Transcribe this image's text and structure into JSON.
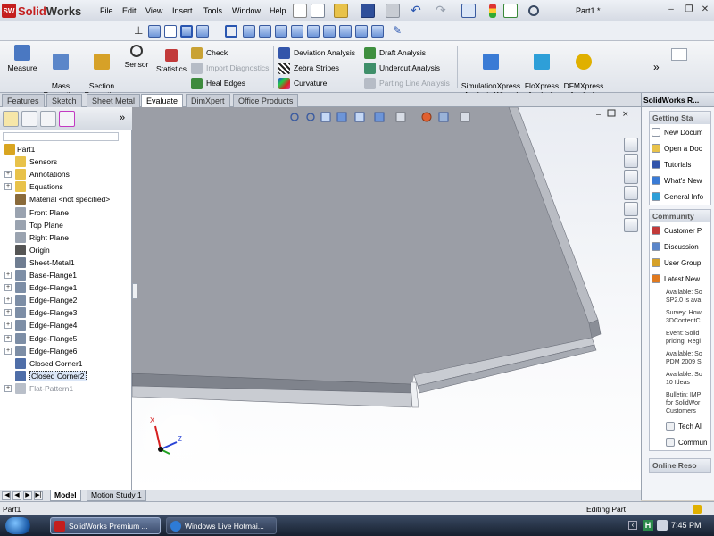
{
  "app": {
    "logo_badge": "SW",
    "logo_text_a": "Solid",
    "logo_text_b": "Works",
    "doc_title": "Part1 *",
    "win_minimize": "–",
    "win_restore": "❐",
    "win_close": "✕"
  },
  "menu": [
    "File",
    "Edit",
    "View",
    "Insert",
    "Tools",
    "Window",
    "Help"
  ],
  "command_manager": {
    "large_buttons": [
      {
        "label": "Measure",
        "icon": "ruler-icon",
        "color": "#4a78c2"
      },
      {
        "label": "Mass\nProperties",
        "icon": "scale-icon",
        "color": "#5b86c9"
      },
      {
        "label": "Section\nProperties",
        "icon": "section-icon",
        "color": "#d6a128"
      },
      {
        "label": "Sensor",
        "icon": "sensor-icon",
        "color": "#333333"
      },
      {
        "label": "Statistics",
        "icon": "statistics-icon",
        "color": "#c23a3a"
      }
    ],
    "small_col1": [
      {
        "label": "Check",
        "icon": "check-icon",
        "color": "#c9a235",
        "disabled": false
      },
      {
        "label": "Import Diagnostics",
        "icon": "diagnostics-icon",
        "color": "#b6bcc6",
        "disabled": true
      },
      {
        "label": "Heal Edges",
        "icon": "heal-edges-icon",
        "color": "#3d8a3d",
        "disabled": false
      }
    ],
    "small_col2": [
      {
        "label": "Deviation Analysis",
        "icon": "deviation-icon",
        "color": "#3355aa",
        "disabled": false
      },
      {
        "label": "Zebra Stripes",
        "icon": "zebra-icon",
        "color": "#222222",
        "disabled": false
      },
      {
        "label": "Curvature",
        "icon": "curvature-icon",
        "color": "#d43fa6",
        "disabled": false
      }
    ],
    "small_col3": [
      {
        "label": "Draft Analysis",
        "icon": "draft-icon",
        "color": "#3f8f3f",
        "disabled": false
      },
      {
        "label": "Undercut Analysis",
        "icon": "undercut-icon",
        "color": "#3f8f6a",
        "disabled": false
      },
      {
        "label": "Parting Line Analysis",
        "icon": "parting-line-icon",
        "color": "#b6bcc6",
        "disabled": true
      }
    ],
    "xpress_buttons": [
      {
        "label": "SimulationXpress\nAnalysis Wizard",
        "icon": "simulationxpress-icon",
        "color": "#3a7bd5"
      },
      {
        "label": "FloXpress\nAnalysis\nWizard",
        "icon": "floxpress-icon",
        "color": "#2e9fd8"
      },
      {
        "label": "DFMXpress\nAnalysis\nWizard",
        "icon": "dfmxpress-icon",
        "color": "#e0b000"
      }
    ],
    "more_chevron": "»"
  },
  "tabs": [
    {
      "label": "Features",
      "active": false
    },
    {
      "label": "Sketch",
      "active": false
    },
    {
      "label": "Sheet Metal",
      "active": false
    },
    {
      "label": "Evaluate",
      "active": true
    },
    {
      "label": "DimXpert",
      "active": false
    },
    {
      "label": "Office Products",
      "active": false
    }
  ],
  "feature_tree": [
    {
      "label": "Part1",
      "icon": "part-icon",
      "color": "#d9a520",
      "expand": "",
      "root": true
    },
    {
      "label": "Sensors",
      "icon": "sensors-folder-icon",
      "color": "#e8c24a",
      "expand": ""
    },
    {
      "label": "Annotations",
      "icon": "annotations-icon",
      "color": "#e8c24a",
      "expand": "+"
    },
    {
      "label": "Equations",
      "icon": "equations-icon",
      "color": "#e8c24a",
      "expand": "+"
    },
    {
      "label": "Material <not specified>",
      "icon": "material-icon",
      "color": "#8a6a3a",
      "expand": ""
    },
    {
      "label": "Front Plane",
      "icon": "plane-icon",
      "color": "#9aa3b0",
      "expand": ""
    },
    {
      "label": "Top Plane",
      "icon": "plane-icon",
      "color": "#9aa3b0",
      "expand": ""
    },
    {
      "label": "Right Plane",
      "icon": "plane-icon",
      "color": "#9aa3b0",
      "expand": ""
    },
    {
      "label": "Origin",
      "icon": "origin-icon",
      "color": "#555555",
      "expand": ""
    },
    {
      "label": "Sheet-Metal1",
      "icon": "sheet-metal-icon",
      "color": "#6f7d91",
      "expand": ""
    },
    {
      "label": "Base-Flange1",
      "icon": "flange-icon",
      "color": "#7d8ea6",
      "expand": "+"
    },
    {
      "label": "Edge-Flange1",
      "icon": "flange-icon",
      "color": "#7d8ea6",
      "expand": "+"
    },
    {
      "label": "Edge-Flange2",
      "icon": "flange-icon",
      "color": "#7d8ea6",
      "expand": "+"
    },
    {
      "label": "Edge-Flange3",
      "icon": "flange-icon",
      "color": "#7d8ea6",
      "expand": "+"
    },
    {
      "label": "Edge-Flange4",
      "icon": "flange-icon",
      "color": "#7d8ea6",
      "expand": "+"
    },
    {
      "label": "Edge-Flange5",
      "icon": "flange-icon",
      "color": "#7d8ea6",
      "expand": "+"
    },
    {
      "label": "Edge-Flange6",
      "icon": "flange-icon",
      "color": "#7d8ea6",
      "expand": "+"
    },
    {
      "label": "Closed Corner1",
      "icon": "closed-corner-icon",
      "color": "#4f6ea8",
      "expand": ""
    },
    {
      "label": "Closed Corner2",
      "icon": "closed-corner-icon",
      "color": "#4f6ea8",
      "expand": "",
      "selected": true
    },
    {
      "label": "Flat-Pattern1",
      "icon": "flat-pattern-icon",
      "color": "#b9bfc9",
      "expand": "+",
      "suppressed": true
    }
  ],
  "task_pane": {
    "title": "SolidWorks R...",
    "getting_started": {
      "header": "Getting Sta",
      "links": [
        {
          "label": "New Docum",
          "icon": "new-document-icon",
          "color": "#ffffff"
        },
        {
          "label": "Open a Doc",
          "icon": "open-folder-icon",
          "color": "#e8c24a"
        },
        {
          "label": "Tutorials",
          "icon": "tutorials-icon",
          "color": "#3355aa"
        },
        {
          "label": "What's New",
          "icon": "whats-new-icon",
          "color": "#3a7bd5"
        },
        {
          "label": "General Info",
          "icon": "info-icon",
          "color": "#2e9fd8"
        }
      ]
    },
    "community": {
      "header": "Community",
      "links": [
        {
          "label": "Customer P",
          "icon": "customer-portal-icon",
          "color": "#c23a3a"
        },
        {
          "label": "Discussion",
          "icon": "discussion-icon",
          "color": "#5b86c9"
        },
        {
          "label": "User Group",
          "icon": "user-group-icon",
          "color": "#d6a128"
        },
        {
          "label": "Latest New",
          "icon": "rss-icon",
          "color": "#e07a1f"
        }
      ],
      "news": [
        {
          "l1": "Available: So",
          "l2": "SP2.0 is ava"
        },
        {
          "l1": "Survey: How",
          "l2": "3DContentC"
        },
        {
          "l1": "Event: Solid",
          "l2": "pricing. Regi"
        },
        {
          "l1": "Available: So",
          "l2": "PDM 2009 S"
        },
        {
          "l1": "Available: So",
          "l2": "10 Ideas"
        },
        {
          "l1": "Bulletin: IMP",
          "l2": "for SolidWor",
          "l3": "Customers"
        }
      ],
      "footer_links": [
        {
          "label": "Tech Al",
          "icon": "tech-alerts-icon"
        },
        {
          "label": "Commun",
          "icon": "community-icon"
        }
      ]
    },
    "online_resources": "Online Reso"
  },
  "bottom": {
    "tabs": [
      {
        "label": "Model",
        "active": true
      },
      {
        "label": "Motion Study 1",
        "active": false
      }
    ],
    "nav": [
      "|◀",
      "◀",
      "▶",
      "▶|"
    ]
  },
  "status": {
    "left": "Part1",
    "right": "Editing Part"
  },
  "taskbar": {
    "tasks": [
      {
        "label": "SolidWorks Premium ...",
        "icon": "solidworks-task-icon",
        "color": "#c41e1e",
        "active": true
      },
      {
        "label": "Windows Live Hotmai...",
        "icon": "ie-icon",
        "color": "#2e7bd6",
        "active": false
      }
    ],
    "tray_lang": "H",
    "time": "7:45 PM"
  },
  "triad": {
    "x": "X",
    "z": "Z"
  },
  "colors": {
    "accent": "#3a5ba0",
    "model_face": "#9b9ea6",
    "model_edge": "#6e727c"
  }
}
